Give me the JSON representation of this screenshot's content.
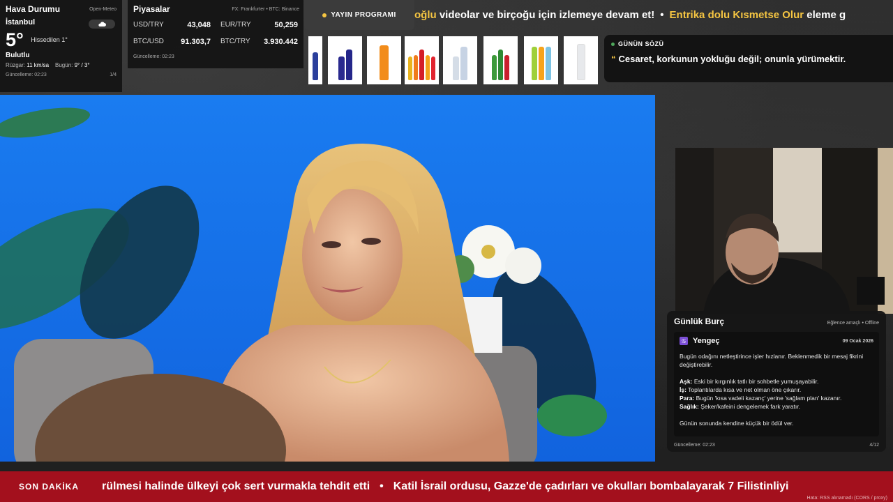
{
  "weather": {
    "title": "Hava Durumu",
    "source": "Open-Meteo",
    "city": "İstanbul",
    "temperature": "5°",
    "feels_like": "Hissedilen 1°",
    "condition": "Bulutlu",
    "wind_label": "Rüzgar:",
    "wind_value": "11 km/sa",
    "today_label": "Bugün:",
    "today_value": "9° / 3°",
    "updated": "Güncelleme: 02:23",
    "page": "1/4",
    "icon": "cloud-icon"
  },
  "markets": {
    "title": "Piyasalar",
    "source": "FX: Frankfurter • BTC: Binance",
    "pairs": [
      {
        "label": "USD/TRY",
        "value": "43,048"
      },
      {
        "label": "EUR/TRY",
        "value": "50,259"
      },
      {
        "label": "BTC/USD",
        "value": "91.303,7"
      },
      {
        "label": "BTC/TRY",
        "value": "3.930.442"
      }
    ],
    "updated": "Güncelleme: 02:23"
  },
  "top_ticker": {
    "badge": "YAYIN PROGRAMI",
    "items": [
      {
        "text": "oğlu",
        "highlight": true
      },
      {
        "text": " videolar ve birçoğu için izlemeye devam et!",
        "highlight": false
      },
      {
        "text": "Entrika dolu Kısmetse Olur",
        "highlight": true
      },
      {
        "text": " eleme g",
        "highlight": false
      }
    ],
    "separator": "•"
  },
  "quote": {
    "title": "GÜNÜN SÖZÜ",
    "mark": "“",
    "text": "Cesaret, korkunun yokluğu değil; onunla yürümektir."
  },
  "horoscope": {
    "title": "Günlük Burç",
    "tag": "Eğlence amaçlı • Offline",
    "sign": "Yengeç",
    "date": "09 Ocak 2026",
    "intro": "Bugün odağını netleştirince işler hızlanır. Beklenmedik bir mesaj fikrini değiştirebilir.",
    "love_label": "Aşk:",
    "love": "Eski bir kırgınlık tatlı bir sohbetle yumuşayabilir.",
    "work_label": "İş:",
    "work": "Toplantılarda kısa ve net olman öne çıkarır.",
    "money_label": "Para:",
    "money": "Bugün 'kısa vadeli kazanç' yerine 'sağlam plan' kazanır.",
    "health_label": "Sağlık:",
    "health": "Şeker/kafeini dengelemek fark yaratır.",
    "closing": "Günün sonunda kendine küçük bir ödül ver.",
    "updated": "Güncelleme: 02:23",
    "page": "4/12"
  },
  "breaking": {
    "label": "SON DAKİKA",
    "item1": "rülmesi halinde ülkeyi çok sert vurmakla tehdit etti",
    "separator": "•",
    "item2": "Katil İsrail ordusu, Gazze'de çadırları ve okulları bombalayarak 7 Filistinliyi",
    "rss_note": "Hata: RSS alınamadı (CORS / proxy)"
  },
  "colors": {
    "accent": "#f5c542",
    "breaking": "#a3101d",
    "video_bg": "#1a7cf0"
  }
}
